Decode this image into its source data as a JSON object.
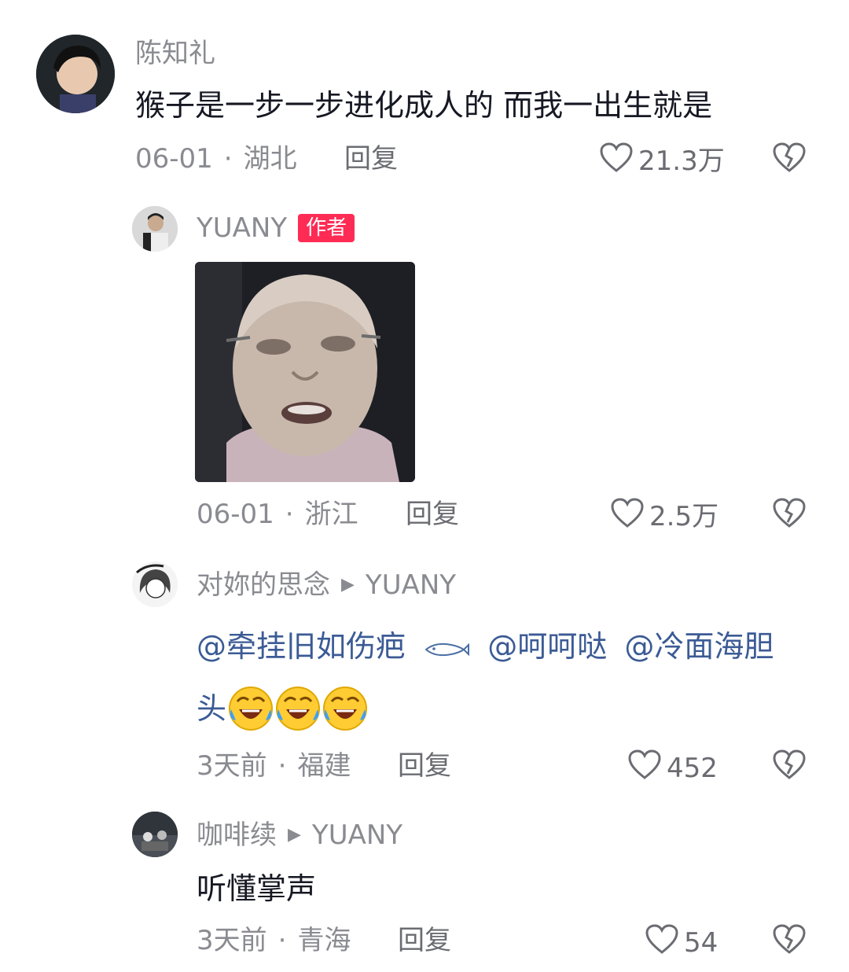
{
  "comments": [
    {
      "user": "陈知礼",
      "text": "猴子是一步一步进化成人的 而我一出生就是",
      "date": "06-01",
      "location": "湖北",
      "reply_label": "回复",
      "likes": "21.3万",
      "replies": [
        {
          "user": "YUANY",
          "badge": "作者",
          "date": "06-01",
          "location": "浙江",
          "reply_label": "回复",
          "likes": "2.5万"
        },
        {
          "user": "对妳的思念",
          "reply_to": "YUANY",
          "mentions": [
            "@牵挂旧如伤疤",
            "@呵呵哒",
            "@冷面海胆",
            "头"
          ],
          "date": "3天前",
          "location": "福建",
          "reply_label": "回复",
          "likes": "452"
        },
        {
          "user": "咖啡续",
          "reply_to": "YUANY",
          "text": "听懂掌声",
          "date": "3天前",
          "location": "青海",
          "reply_label": "回复",
          "likes": "54"
        }
      ]
    }
  ],
  "colors": {
    "badge": "#fe2c55",
    "mention": "#3b5b95",
    "meta": "#8a8b91"
  },
  "icons": [
    "heart-icon",
    "broken-heart-icon",
    "fish-icon",
    "laughing-tears-emoji",
    "triangle-arrow-icon"
  ]
}
